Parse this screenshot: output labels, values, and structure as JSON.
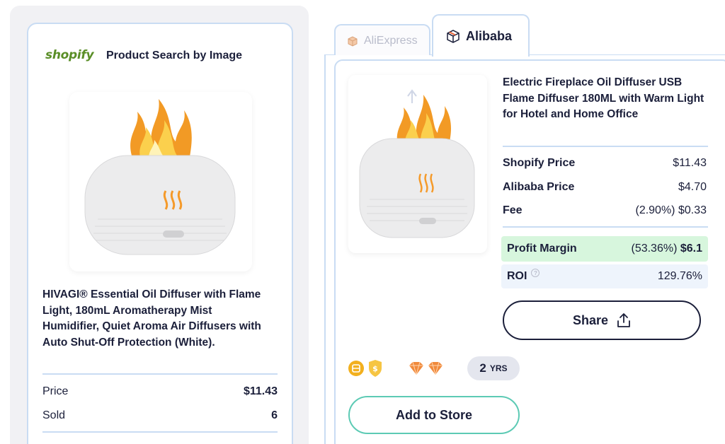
{
  "left_panel": {
    "brand_logo": "shopify",
    "header_title": "Product Search by Image",
    "product_title": "HIVAGI® Essential Oil Diffuser with Flame Light, 180mL Aromatherapy Mist Humidifier, Quiet Aroma Air Diffusers with Auto Shut-Off Protection (White).",
    "rows": [
      {
        "label": "Price",
        "value": "$11.43"
      },
      {
        "label": "Sold",
        "value": "6"
      }
    ]
  },
  "tabs": [
    {
      "label": "AliExpress",
      "active": false,
      "icon": "aliexpress-box-icon"
    },
    {
      "label": "Alibaba",
      "active": true,
      "icon": "alibaba-box-icon"
    }
  ],
  "right_panel": {
    "product_title": "Electric Fireplace Oil Diffuser USB Flame Diffuser 180ML with Warm Light for Hotel and Home Office",
    "rows": [
      {
        "label": "Shopify Price",
        "value": "$11.43"
      },
      {
        "label": "Alibaba Price",
        "value": "$4.70"
      },
      {
        "label": "Fee",
        "value": "(2.90%) $0.33"
      }
    ],
    "profit": {
      "label": "Profit Margin",
      "percent": "(53.36%)",
      "amount": "$6.1"
    },
    "roi": {
      "label": "ROI",
      "value": "129.76%",
      "help_icon": "question-circle-icon"
    },
    "share_label": "Share",
    "years_number": "2",
    "years_unit": "YRS",
    "add_to_store_label": "Add to Store"
  },
  "colors": {
    "accent_border": "#c9dcf3",
    "profit_bg": "#d7f6dd",
    "roi_bg": "#eef4fc",
    "add_store_border": "#5ccab4",
    "text_dark": "#1b1f3a",
    "shopify_green": "#5a8e27",
    "diamond_orange": "#f08a3c",
    "gold_badge": "#f2b01e"
  }
}
